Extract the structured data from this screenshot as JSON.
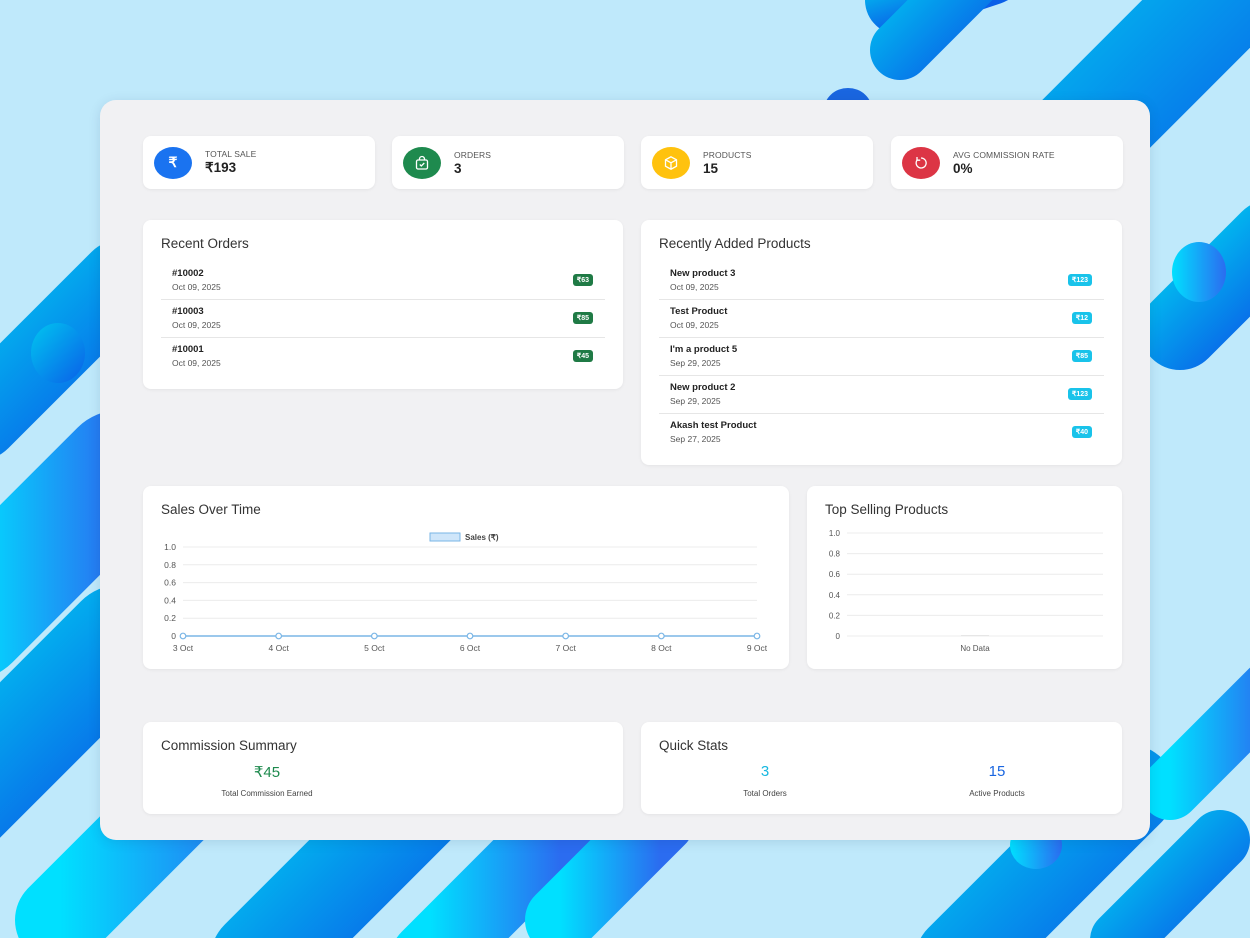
{
  "stats": [
    {
      "label": "TOTAL SALE",
      "value": "₹193",
      "icon": "rupee-icon",
      "color": "#1a73f0"
    },
    {
      "label": "ORDERS",
      "value": "3",
      "icon": "shopping-bag-icon",
      "color": "#1e8a4e"
    },
    {
      "label": "PRODUCTS",
      "value": "15",
      "icon": "box-icon",
      "color": "#ffc20e"
    },
    {
      "label": "AVG COMMISSION RATE",
      "value": "0%",
      "icon": "refresh-icon",
      "color": "#dc3545"
    }
  ],
  "recent_orders": {
    "title": "Recent Orders",
    "items": [
      {
        "id": "#10002",
        "date": "Oct 09, 2025",
        "amount": "₹63"
      },
      {
        "id": "#10003",
        "date": "Oct 09, 2025",
        "amount": "₹85"
      },
      {
        "id": "#10001",
        "date": "Oct 09, 2025",
        "amount": "₹45"
      }
    ]
  },
  "recent_products": {
    "title": "Recently Added Products",
    "items": [
      {
        "name": "New product 3",
        "date": "Oct 09, 2025",
        "price": "₹123"
      },
      {
        "name": "Test Product",
        "date": "Oct 09, 2025",
        "price": "₹12"
      },
      {
        "name": "I'm a product 5",
        "date": "Sep 29, 2025",
        "price": "₹85"
      },
      {
        "name": "New product 2",
        "date": "Sep 29, 2025",
        "price": "₹123"
      },
      {
        "name": "Akash test Product",
        "date": "Sep 27, 2025",
        "price": "₹40"
      }
    ]
  },
  "sales_chart": {
    "title": "Sales Over Time"
  },
  "top_selling": {
    "title": "Top Selling Products"
  },
  "chart_data": [
    {
      "type": "line",
      "legend": "Sales (₹)",
      "legend_position": "top",
      "categories": [
        "3 Oct",
        "4 Oct",
        "5 Oct",
        "6 Oct",
        "7 Oct",
        "8 Oct",
        "9 Oct"
      ],
      "series": [
        {
          "name": "Sales (₹)",
          "values": [
            0,
            0,
            0,
            0,
            0,
            0,
            0
          ]
        }
      ],
      "yticks": [
        "0",
        "0.2",
        "0.4",
        "0.6",
        "0.8",
        "1.0"
      ],
      "ylim": [
        0,
        1
      ],
      "grid": true,
      "color": "#7ab6e6"
    },
    {
      "type": "bar",
      "categories": [
        "No Data"
      ],
      "values": [
        0
      ],
      "yticks": [
        "0",
        "0.2",
        "0.4",
        "0.6",
        "0.8",
        "1.0"
      ],
      "ylim": [
        0,
        1
      ],
      "grid": true
    }
  ],
  "commission": {
    "title": "Commission Summary",
    "value": "₹45",
    "label": "Total Commission Earned",
    "color": "#1e8a4e"
  },
  "quick_stats": {
    "title": "Quick Stats",
    "orders_value": "3",
    "orders_label": "Total Orders",
    "orders_color": "#17b8e0",
    "products_value": "15",
    "products_label": "Active Products",
    "products_color": "#1a66e0"
  }
}
